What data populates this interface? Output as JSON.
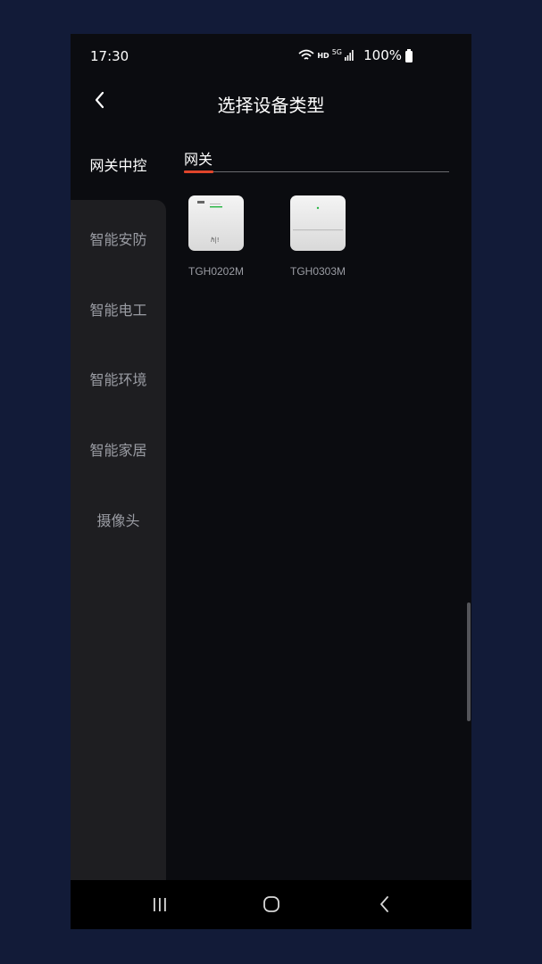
{
  "status": {
    "time": "17:30",
    "network": "HD",
    "signal": "5G",
    "battery": "100%"
  },
  "header": {
    "title": "选择设备类型"
  },
  "sidebar": {
    "items": [
      {
        "label": "网关中控"
      },
      {
        "label": "智能安防"
      },
      {
        "label": "智能电工"
      },
      {
        "label": "智能环境"
      },
      {
        "label": "智能家居"
      },
      {
        "label": "摄像头"
      }
    ]
  },
  "tabs": [
    {
      "label": "网关"
    }
  ],
  "devices": [
    {
      "name": "TGH0202M"
    },
    {
      "name": "TGH0303M"
    }
  ],
  "colors": {
    "accent": "#e0452b",
    "background": "#0b0c10",
    "sidebar": "#1e1e21"
  }
}
